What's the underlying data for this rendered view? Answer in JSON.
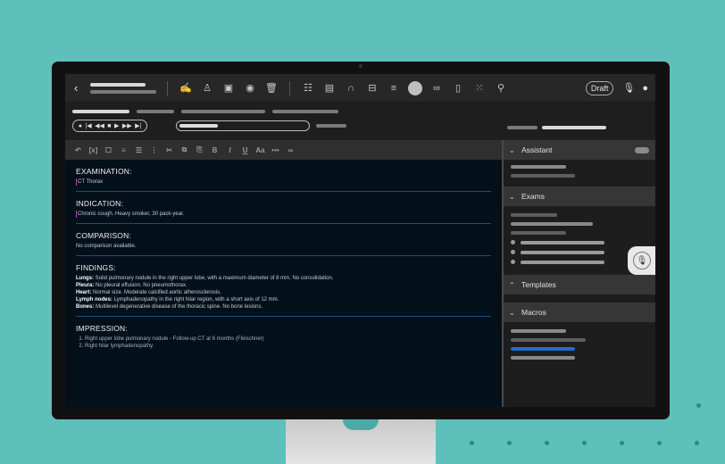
{
  "toolbar": {
    "back_icon": "chevron-left-icon",
    "draft_label": "Draft",
    "icons": [
      "signature-icon",
      "user-icon",
      "save-icon",
      "preview-icon",
      "trash-icon",
      "report-icon",
      "pdf-icon",
      "headset-icon",
      "toggle-icon",
      "list-icon",
      "link-icon",
      "document-icon",
      "grid-icon",
      "tree-icon"
    ]
  },
  "player": {
    "controls": [
      "●",
      "|◀",
      "◀◀",
      "■",
      "▶",
      "▶▶",
      "▶|"
    ]
  },
  "format_bar": {
    "buttons": [
      "↶",
      "[x]",
      "☐",
      "≡",
      "☰",
      "✂",
      "⧉",
      "⎘",
      "B",
      "I",
      "U",
      "Aa",
      "•••",
      "∞"
    ]
  },
  "report": {
    "examination": {
      "heading": "EXAMINATION:",
      "text": "CT Thorax"
    },
    "indication": {
      "heading": "INDICATION:",
      "text": "Chronic cough. Heavy smoker, 30 pack-year."
    },
    "comparison": {
      "heading": "COMPARISON:",
      "text": "No comparison available."
    },
    "findings": {
      "heading": "FINDINGS:",
      "items": [
        {
          "label": "Lungs:",
          "text": "Solid pulmonary nodule in the right upper lobe, with a maximum diameter of 8 mm. No consolidation."
        },
        {
          "label": "Pleura:",
          "text": "No pleural effusion. No pneumothorax."
        },
        {
          "label": "Heart:",
          "text": "Normal size. Moderate calcified aortic atherosclerosis."
        },
        {
          "label": "Lymph nodes:",
          "text": "Lymphadenopathy in the right hilar region, with a short axis of 12 mm."
        },
        {
          "label": "Bones:",
          "text": "Multilevel degenerative disease of the thoracic spine. No bone lesions."
        }
      ]
    },
    "impression": {
      "heading": "IMPRESSION:",
      "items": [
        "Right upper lobe pulmonary nodule - Follow-up CT at 6 months (Fleischner)",
        "Right hilar lymphadenopathy."
      ]
    }
  },
  "panel": {
    "assistant": "Assistant",
    "exams": "Exams",
    "templates": "Templates",
    "macros": "Macros"
  },
  "colors": {
    "background": "#5fbfba",
    "editor_bg": "#03101a",
    "section_rule": "#1e4a7a",
    "macro_accent": "#1c6fd1",
    "cursor": "#c83ec8"
  }
}
